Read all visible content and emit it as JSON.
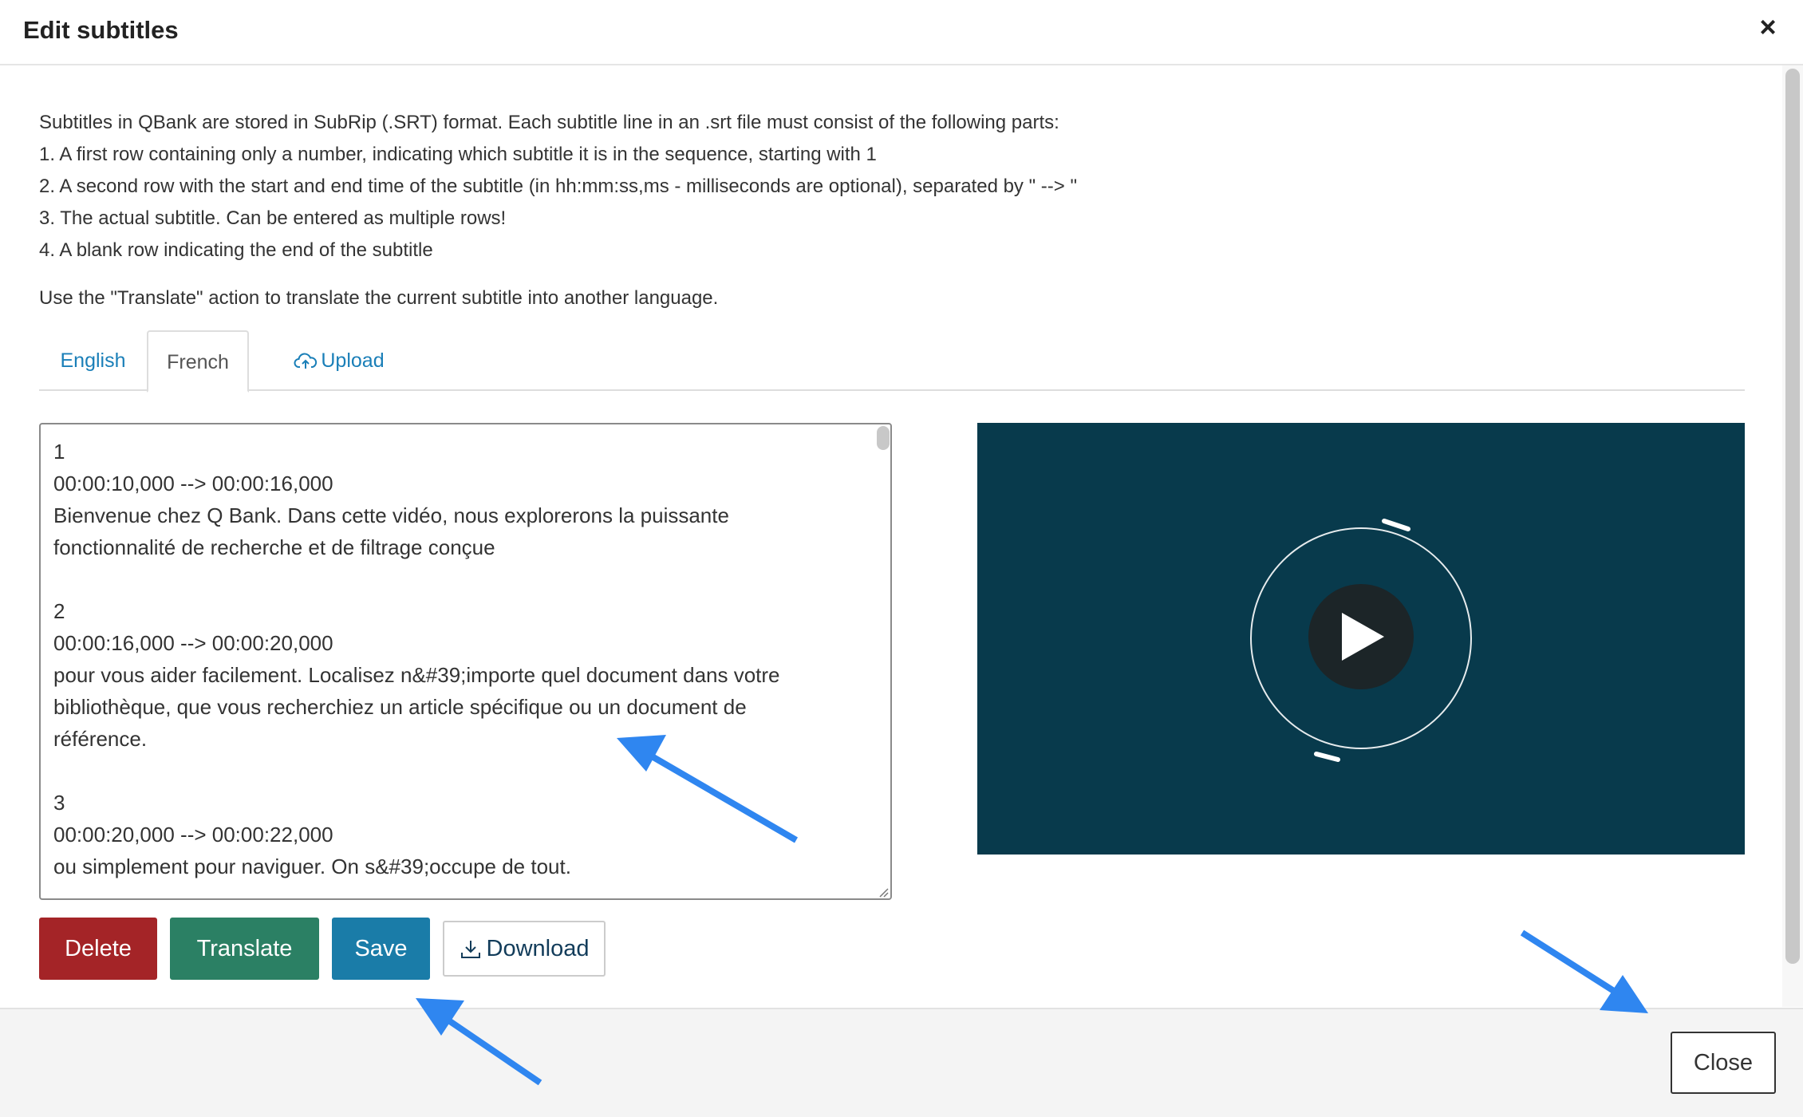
{
  "dialog": {
    "title": "Edit subtitles",
    "close_icon": "×"
  },
  "instructions": {
    "lines": [
      "Subtitles in QBank are stored in SubRip (.SRT) format. Each subtitle line in an .srt file must consist of the following parts:",
      "1. A first row containing only a number, indicating which subtitle it is in the sequence, starting with 1",
      "2. A second row with the start and end time of the subtitle (in hh:mm:ss,ms - milliseconds are optional), separated by \" --> \"",
      "3. The actual subtitle. Can be entered as multiple rows!",
      "4. A blank row indicating the end of the subtitle"
    ],
    "translate_note": "Use the \"Translate\" action to translate the current subtitle into another language."
  },
  "tabs": {
    "english": "English",
    "french": "French",
    "upload": "Upload",
    "active": "French",
    "upload_icon": "cloud-upload-icon"
  },
  "editor": {
    "content": "1\n00:00:10,000 --> 00:00:16,000\nBienvenue chez Q Bank. Dans cette vidéo, nous explorerons la puissante\nfonctionnalité de recherche et de filtrage conçue\n\n2\n00:00:16,000 --> 00:00:20,000\npour vous aider facilement. Localisez n&#39;importe quel document dans votre\nbibliothèque, que vous recherchiez un article spécifique ou un document de\nréférence.\n\n3\n00:00:20,000 --> 00:00:22,000\nou simplement pour naviguer. On s&#39;occupe de tout."
  },
  "video": {
    "background": "#083a4c",
    "play_icon": "play-icon"
  },
  "actions": {
    "delete": "Delete",
    "translate": "Translate",
    "save": "Save",
    "download": "Download",
    "download_icon": "download-icon"
  },
  "footer": {
    "close": "Close"
  },
  "colors": {
    "delete": "#a42427",
    "translate": "#2b8064",
    "save": "#1a7ca8",
    "link": "#1a7fb8",
    "annotation_arrow": "#2f86f0"
  }
}
